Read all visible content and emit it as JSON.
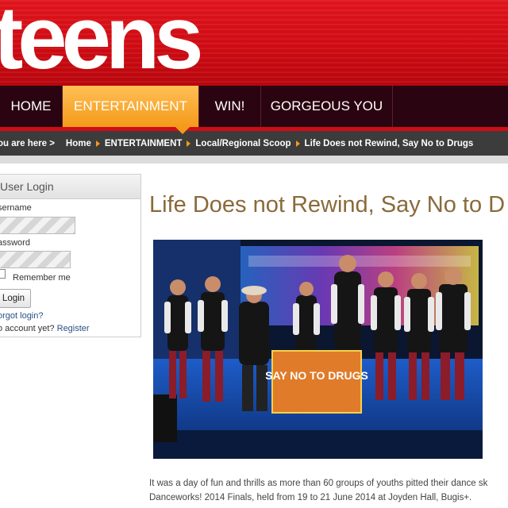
{
  "header": {
    "logo_text": "teens"
  },
  "nav": {
    "items": [
      {
        "label": "HOME",
        "active": false
      },
      {
        "label": "ENTERTAINMENT",
        "active": true
      },
      {
        "label": "WIN!",
        "active": false
      },
      {
        "label": "GORGEOUS YOU",
        "active": false
      }
    ]
  },
  "breadcrumb": {
    "prefix": "ou are here >",
    "items": [
      "Home",
      "ENTERTAINMENT",
      "Local/Regional Scoop",
      "Life Does not Rewind, Say No to Drugs"
    ]
  },
  "login": {
    "title": "User Login",
    "username_label": "sername",
    "password_label": "assword",
    "remember_label": "Remember me",
    "button_label": "Login",
    "forgot_link": "orgot login?",
    "no_account_text": "o account yet?",
    "register_link": "Register"
  },
  "article": {
    "title": "Life Does not Rewind, Say No to D",
    "photo_banner": "SAY NO TO DRUGS",
    "body_line1": "It was a day of fun and thrills as more than 60 groups of youths pitted their dance sk",
    "body_line2": "Danceworks! 2014 Finals, held from 19 to 21 June 2014 at Joyden Hall, Bugis+."
  },
  "colors": {
    "brand_red": "#d10c15",
    "nav_dark": "#2a0410",
    "accent_orange": "#f49a1a",
    "title_brown": "#8a6a3a"
  }
}
